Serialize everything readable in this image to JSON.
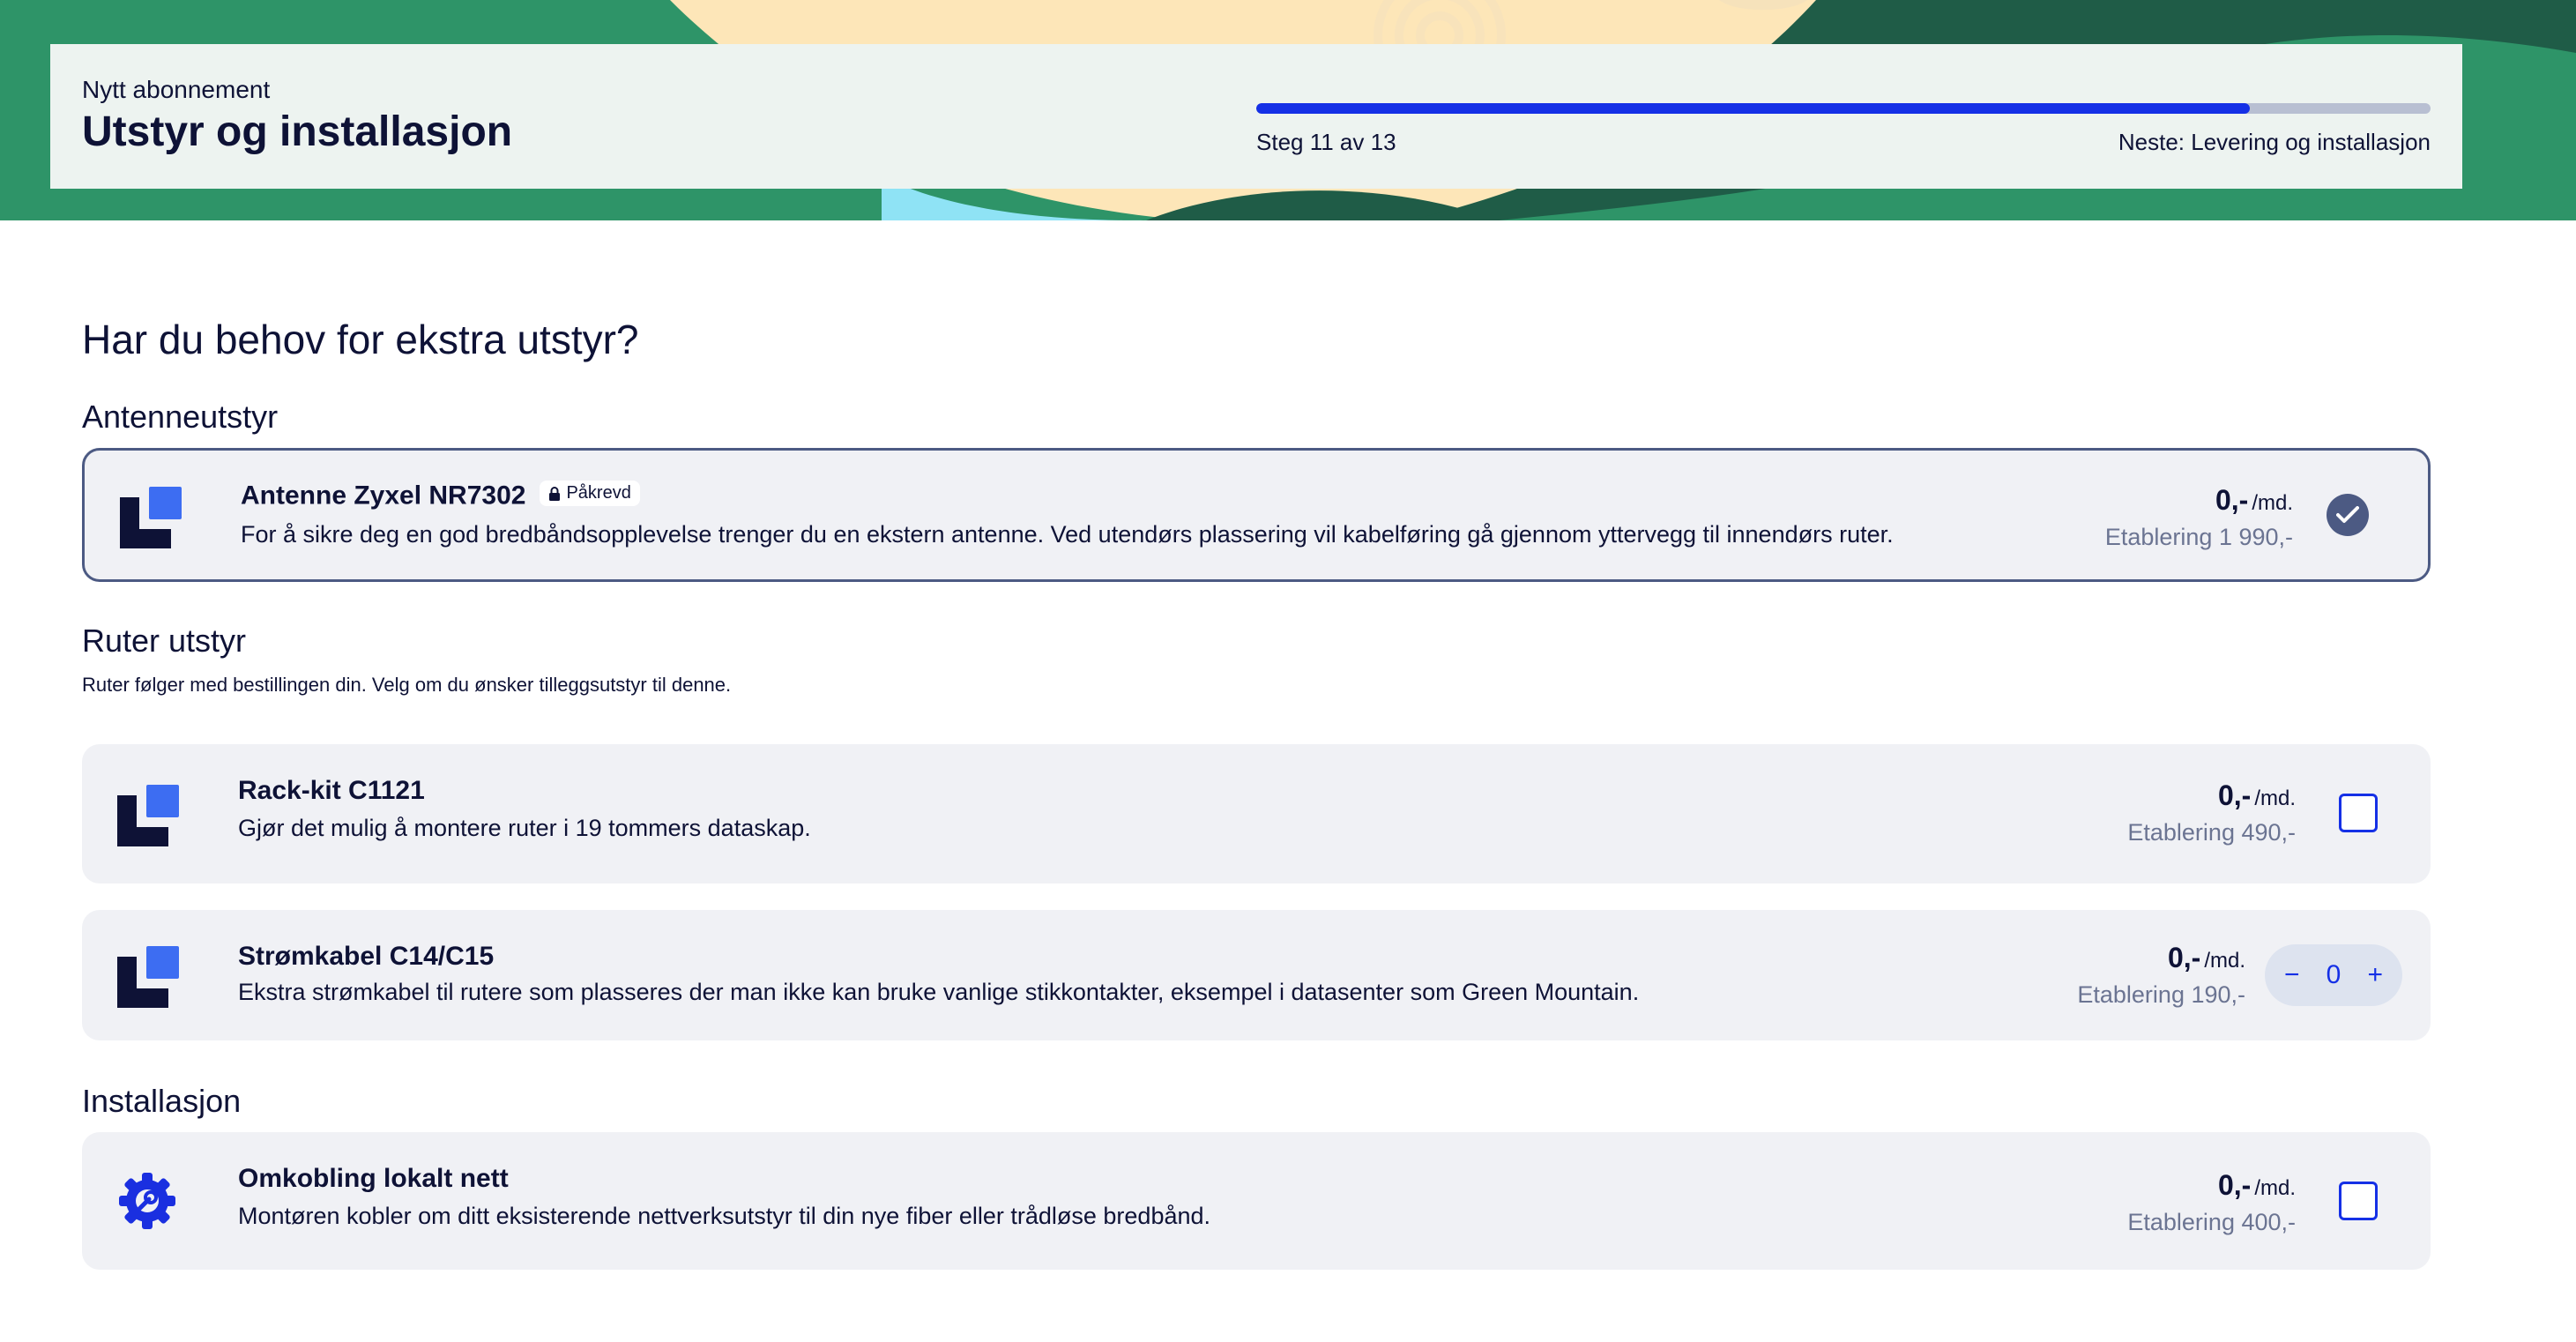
{
  "header": {
    "eyebrow": "Nytt abonnement",
    "title": "Utstyr og installasjon",
    "progress": {
      "current": 11,
      "total": 13,
      "fraction": 0.846
    },
    "step_label": "Steg 11 av 13",
    "next_label": "Neste: Levering og installasjon"
  },
  "main": {
    "question": "Har du behov for ekstra utstyr?",
    "sections": [
      {
        "title": "Antenneutstyr",
        "items": [
          {
            "name": "Antenne Zyxel NR7302",
            "badge": "Påkrevd",
            "description": "For å sikre deg en god bredbåndsopplevelse trenger du en ekstern antenne. Ved utendørs plassering vil kabelføring gå gjennom yttervegg til innendørs ruter.",
            "price": "0,-",
            "unit": "/md.",
            "establishment": "Etablering 1 990,-",
            "control": "checked-required"
          }
        ]
      },
      {
        "title": "Ruter utstyr",
        "subtitle": "Ruter følger med bestillingen din. Velg om du ønsker tilleggsutstyr til denne.",
        "items": [
          {
            "name": "Rack-kit C1121",
            "description": "Gjør det mulig å montere ruter i 19 tommers dataskap.",
            "price": "0,-",
            "unit": "/md.",
            "establishment": "Etablering 490,-",
            "control": "checkbox",
            "checked": false
          },
          {
            "name": "Strømkabel C14/C15",
            "description": "Ekstra strømkabel til rutere som plasseres der man ikke kan bruke vanlige stikkontakter, eksempel i datasenter som Green Mountain.",
            "price": "0,-",
            "unit": "/md.",
            "establishment": "Etablering 190,-",
            "control": "stepper",
            "quantity": "0",
            "minus": "−",
            "plus": "+"
          }
        ]
      },
      {
        "title": "Installasjon",
        "items": [
          {
            "name": "Omkobling lokalt nett",
            "description": "Montøren kobler om ditt eksisterende nettverksutstyr til din nye fiber eller trådløse bredbånd.",
            "price": "0,-",
            "unit": "/md.",
            "establishment": "Etablering 400,-",
            "control": "checkbox",
            "checked": false
          }
        ]
      }
    ]
  },
  "icons": {
    "product": "product-logo-icon",
    "installation": "gear-wrench-icon",
    "lock": "lock-icon",
    "check": "check-icon"
  },
  "colors": {
    "accent": "#1530e6",
    "navy": "#0e1236",
    "card_bg": "#f0f1f5",
    "selected_border": "#4c5a83",
    "hero_green": "#2e9468"
  }
}
